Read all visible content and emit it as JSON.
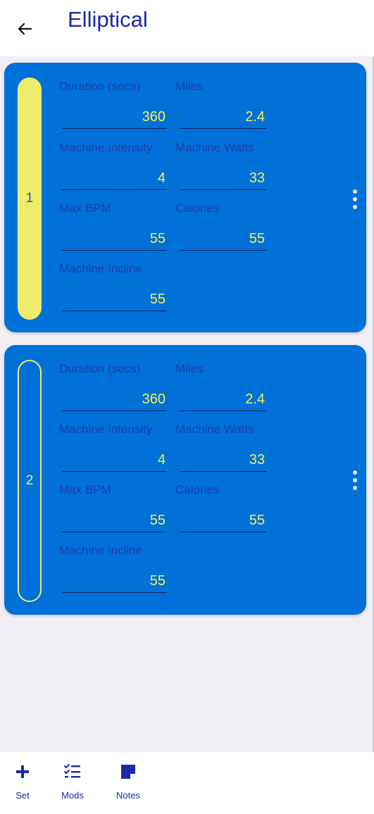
{
  "header": {
    "title": "Elliptical",
    "back_icon": "arrow-left-icon"
  },
  "sets": [
    {
      "number": "1",
      "style": "filled",
      "fields": [
        {
          "label": "Duration (secs)",
          "value": "360"
        },
        {
          "label": "Miles",
          "value": "2.4"
        },
        {
          "label": "Machine Intensity",
          "value": "4"
        },
        {
          "label": "Machine Watts",
          "value": "33"
        },
        {
          "label": "Max BPM",
          "value": "55"
        },
        {
          "label": "Calories",
          "value": "55"
        },
        {
          "label": "Machine Incline",
          "value": "55"
        }
      ]
    },
    {
      "number": "2",
      "style": "outlined",
      "fields": [
        {
          "label": "Duration (secs)",
          "value": "360"
        },
        {
          "label": "Miles",
          "value": "2.4"
        },
        {
          "label": "Machine Intensity",
          "value": "4"
        },
        {
          "label": "Machine Watts",
          "value": "33"
        },
        {
          "label": "Max BPM",
          "value": "55"
        },
        {
          "label": "Calories",
          "value": "55"
        },
        {
          "label": "Machine Incline",
          "value": "55"
        }
      ]
    }
  ],
  "bottom_bar": {
    "items": [
      {
        "label": "Set",
        "icon": "plus-icon"
      },
      {
        "label": "Mods",
        "icon": "checklist-icon"
      },
      {
        "label": "Notes",
        "icon": "note-icon"
      }
    ]
  },
  "colors": {
    "accent": "#1a2aa8",
    "card": "#0071d8",
    "pill": "#eeec6a",
    "value_text": "#f3ef5e",
    "label_text": "#1c3fa8",
    "background": "#f1eff4"
  }
}
